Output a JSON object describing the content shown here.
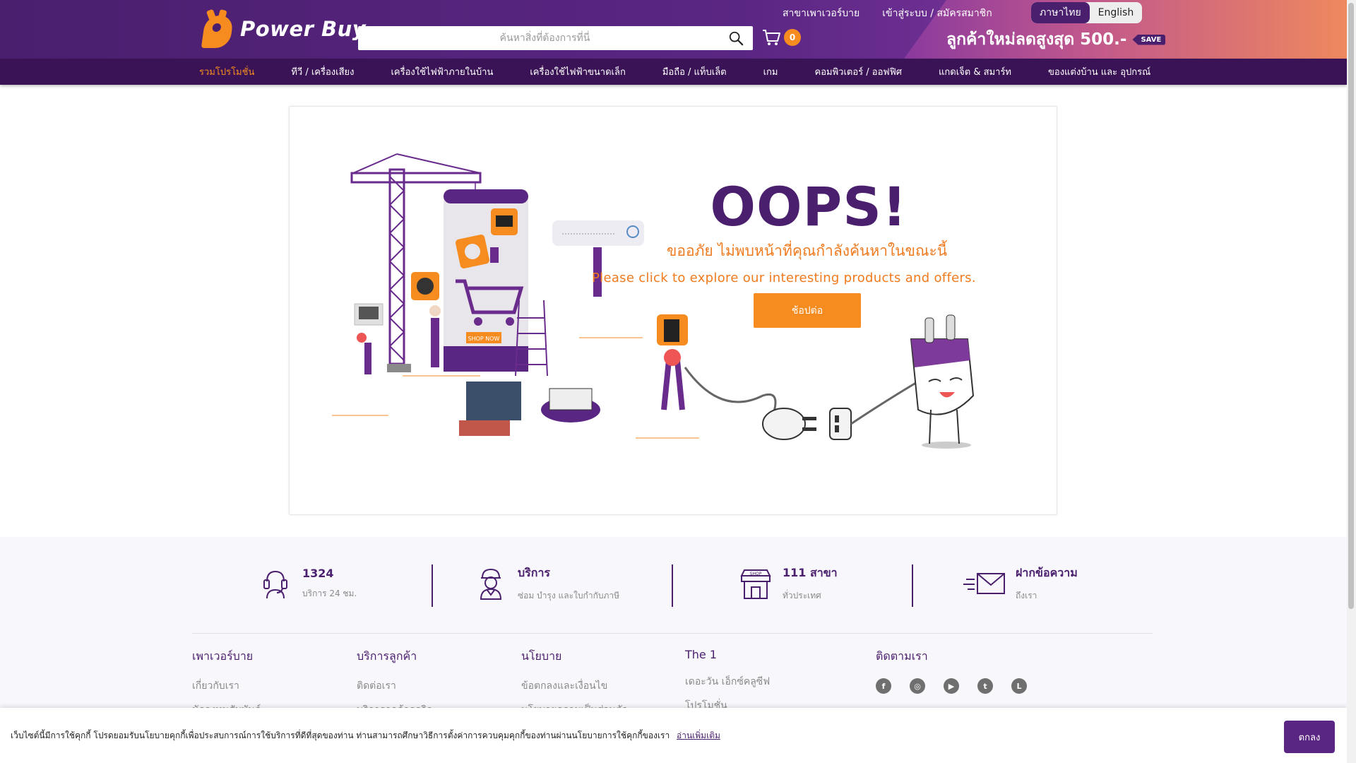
{
  "header": {
    "logo_text": "Power Buy",
    "search_placeholder": "ค้นหาสิ่งที่ต้องการที่นี่",
    "cart_count": "0",
    "top_links": [
      "สาขาเพาเวอร์บาย",
      "เข้าสู่ระบบ / สมัครสมาชิก"
    ],
    "lang_th": "ภาษาไทย",
    "lang_en": "English",
    "promo": "ลูกค้าใหม่ลดสูงสุด 500.-",
    "promo_tag": "SAVE"
  },
  "nav": {
    "items": [
      "รวมโปรโมชั่น",
      "ทีวี / เครื่องเสียง",
      "เครื่องใช้ไฟฟ้าภายในบ้าน",
      "เครื่องใช้ไฟฟ้าขนาดเล็ก",
      "มือถือ / แท็บเล็ต",
      "เกม",
      "คอมพิวเตอร์ / ออฟฟิศ",
      "แกดเจ็ต & สมาร์ท",
      "ของแต่งบ้าน และ อุปกรณ์"
    ]
  },
  "error": {
    "title": "OOPS!",
    "message_th": "ขออภัย ไม่พบหน้าที่คุณกำลังค้นหาในขณะนี้",
    "message_en": "Please click to explore our interesting products and offers.",
    "button": "ช้อปต่อ",
    "illustration_label": "SHOP NOW"
  },
  "services": [
    {
      "icon": "headset-icon",
      "title": "1324",
      "subtitle": "บริการ 24 ชม."
    },
    {
      "icon": "technician-icon",
      "title": "บริการ",
      "subtitle": "ซ่อม บำรุง และใบกำกับภาษี"
    },
    {
      "icon": "shop-icon",
      "title": "111 สาขา",
      "subtitle": "ทั่วประเทศ",
      "icon_label": "SHOP"
    },
    {
      "icon": "mail-icon",
      "title": "ฝากข้อความ",
      "subtitle": "ถึงเรา"
    }
  ],
  "footer": {
    "columns": [
      {
        "title": "เพาเวอร์บาย",
        "links": [
          "เกี่ยวกับเรา",
          "นักลงทุนสัมพันธ์"
        ]
      },
      {
        "title": "บริการลูกค้า",
        "links": [
          "ติดต่อเรา",
          "บริการลูกค้าธุรกิจ"
        ]
      },
      {
        "title": "นโยบาย",
        "links": [
          "ข้อตกลงและเงื่อนไข",
          "นโยบายความเป็นส่วนตัว"
        ]
      },
      {
        "title": "The 1",
        "links": [
          "เดอะวัน เอ็กซ์คลูซีฟ",
          "โปรโมชั่น"
        ]
      }
    ],
    "follow_title": "ติดตามเรา",
    "social": [
      "facebook-icon",
      "instagram-icon",
      "youtube-icon",
      "twitter-icon",
      "line-icon"
    ]
  },
  "cookie": {
    "text": "เว็บไซต์นี้มีการใช้คุกกี้ โปรดยอมรับนโยบายคุกกี้เพื่อประสบการณ์การใช้บริการที่ดีที่สุดของท่าน ท่านสามารถศึกษาวิธีการตั้งค่าการควบคุมคุกกี้ของท่านผ่านนโยบายการใช้คุกกี้ของเรา",
    "link": "อ่านเพิ่มเติม",
    "button": "ตกลง"
  },
  "colors": {
    "brand_purple": "#4a1f6e",
    "brand_orange": "#f68b1f",
    "nav_bg": "#3a1356"
  }
}
